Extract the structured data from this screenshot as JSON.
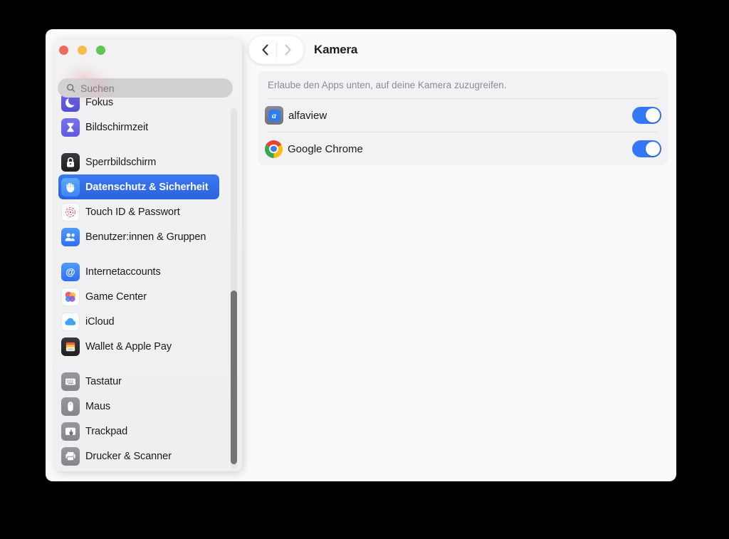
{
  "window": {
    "traffic_lights": [
      "close",
      "minimize",
      "zoom"
    ],
    "sidebar": {
      "search": {
        "placeholder": "Suchen"
      },
      "groups": [
        {
          "items": [
            {
              "label": "Fokus",
              "icon": "moon-icon"
            },
            {
              "label": "Bildschirmzeit",
              "icon": "hourglass-icon"
            }
          ]
        },
        {
          "items": [
            {
              "label": "Sperrbildschirm",
              "icon": "lock-icon"
            },
            {
              "label": "Datenschutz & Sicherheit",
              "icon": "hand-icon",
              "selected": true
            },
            {
              "label": "Touch ID & Passwort",
              "icon": "fingerprint-icon"
            },
            {
              "label": "Benutzer:innen & Gruppen",
              "icon": "users-icon"
            }
          ]
        },
        {
          "items": [
            {
              "label": "Internetaccounts",
              "icon": "at-icon"
            },
            {
              "label": "Game Center",
              "icon": "game-center-icon"
            },
            {
              "label": "iCloud",
              "icon": "cloud-icon"
            },
            {
              "label": "Wallet & Apple Pay",
              "icon": "wallet-icon"
            }
          ]
        },
        {
          "items": [
            {
              "label": "Tastatur",
              "icon": "keyboard-icon"
            },
            {
              "label": "Maus",
              "icon": "mouse-icon"
            },
            {
              "label": "Trackpad",
              "icon": "trackpad-icon"
            },
            {
              "label": "Drucker & Scanner",
              "icon": "printer-icon"
            }
          ]
        }
      ]
    },
    "main": {
      "title": "Kamera",
      "nav": {
        "back_icon": "chevron-left",
        "forward_icon": "chevron-right",
        "back_enabled": true,
        "forward_enabled": false
      },
      "permission_note": "Erlaube den Apps unten, auf deine Kamera zuzugreifen.",
      "apps": [
        {
          "name": "alfaview",
          "enabled": true
        },
        {
          "name": "Google Chrome",
          "enabled": true
        }
      ]
    }
  },
  "colors": {
    "accent_blue": "#3478f6",
    "selected_row_blue": "#2e6ce6",
    "window_bg": "#fbfafb",
    "sidebar_bg": "#f0eff1",
    "card_bg": "#f2f1f3",
    "separator": "#e2e1e4",
    "traffic_red": "#ee6a5f",
    "traffic_yellow": "#f5bd4f",
    "traffic_green": "#61c554"
  }
}
